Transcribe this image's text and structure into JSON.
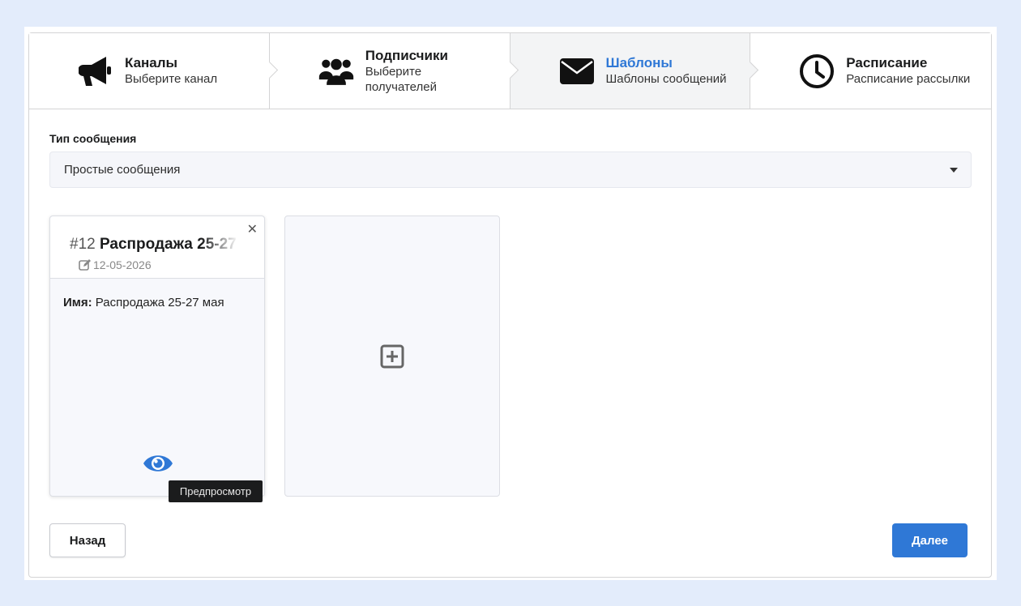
{
  "steps": [
    {
      "title": "Каналы",
      "desc": "Выберите канал",
      "icon": "megaphone-icon"
    },
    {
      "title": "Подписчики",
      "desc": "Выберите получателей",
      "icon": "users-icon"
    },
    {
      "title": "Шаблоны",
      "desc": "Шаблоны сообщений",
      "icon": "envelope-icon",
      "active": true
    },
    {
      "title": "Расписание",
      "desc": "Расписание рассылки",
      "icon": "clock-icon"
    }
  ],
  "message_type": {
    "label": "Тип сообщения",
    "selected": "Простые сообщения"
  },
  "template_card": {
    "number": "#12",
    "title": "Распродажа 25-27",
    "date": "12-05-2026",
    "name_label": "Имя:",
    "name_value": "Распродажа 25-27 мая",
    "preview_tooltip": "Предпросмотр",
    "close_symbol": "✕"
  },
  "buttons": {
    "back": "Назад",
    "next": "Далее"
  },
  "colors": {
    "accent": "#2f78d6",
    "background": "#e3ecfb"
  }
}
